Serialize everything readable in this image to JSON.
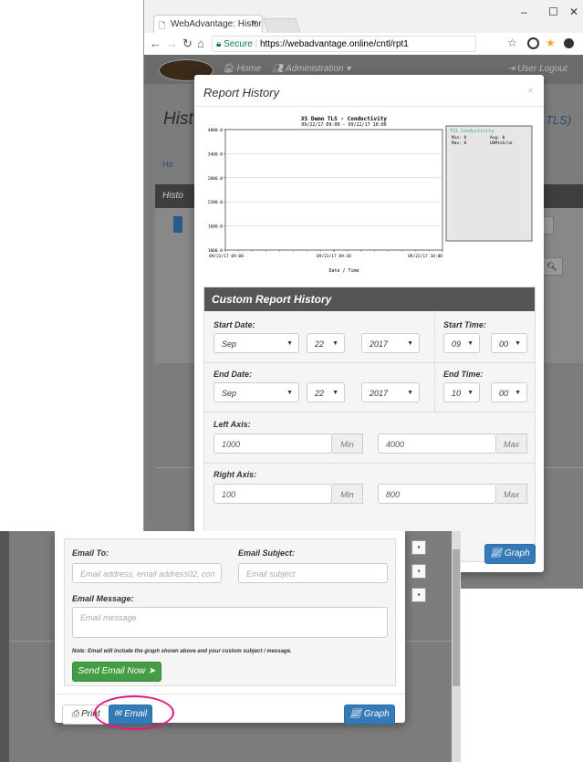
{
  "colors": {
    "primary": "#337ab7",
    "success": "#449d44",
    "highlight": "#e0187f",
    "panel_header": "#555555",
    "overlay": "#7c7c7c"
  },
  "browser": {
    "tab_title": "WebAdvantage: History",
    "tab_close": "×",
    "window_controls": [
      "–",
      "☐",
      "✕"
    ],
    "nav_icons": [
      "back-icon",
      "forward-icon",
      "reload-icon",
      "home-icon"
    ],
    "secure_label": "Secure",
    "url": "https://webadvantage.online/cntl/rpt1"
  },
  "app_nav": {
    "home": "Home",
    "administration": "Administration ▾",
    "logout": "User Logout"
  },
  "background_page": {
    "title_fragment": "Hist",
    "title_suffix": "TLS)",
    "breadcrumb_fragment": "Ho",
    "panel_fragment": "Histo"
  },
  "report_modal": {
    "title": "Report History",
    "close": "×"
  },
  "chart_data": {
    "type": "line",
    "title": "XS Demo TLS - Conductivity",
    "subtitle": "09/22/17 09:00 - 09/22/17 10:00",
    "xlabel": "Date / Time",
    "ylabel": "",
    "x_tick_labels": [
      "09/22/17 09:00",
      "09/22/17 09:30",
      "09/22/17 10:00"
    ],
    "y_tick_labels": [
      "1000.0",
      "1600.0",
      "2200.0",
      "2800.0",
      "3400.0",
      "4000.0"
    ],
    "ylim": [
      1000,
      4000
    ],
    "grid": true,
    "legend_placement": "right",
    "series": [
      {
        "name": "TS1 Conductivity",
        "values": []
      }
    ],
    "legend_stats": {
      "min": "Min: 0",
      "max": "Max: 0",
      "avg": "Avg: 0",
      "units": "UGMtoS/cm"
    }
  },
  "custom_report": {
    "header": "Custom Report History",
    "start_date_label": "Start Date:",
    "start_time_label": "Start Time:",
    "start_month": "Sep",
    "start_day": "22",
    "start_year": "2017",
    "start_hour": "09",
    "start_minute": "00",
    "end_date_label": "End Date:",
    "end_time_label": "End Time:",
    "end_month": "Sep",
    "end_day": "22",
    "end_year": "2017",
    "end_hour": "10",
    "end_minute": "00",
    "left_axis_label": "Left Axis:",
    "left_min": "1000",
    "left_max": "4000",
    "right_axis_label": "Right Axis:",
    "right_min": "100",
    "right_max": "800",
    "min_addon": "Min",
    "max_addon": "Max"
  },
  "graph_button": "Graph",
  "email": {
    "to_label": "Email To:",
    "to_placeholder": "Email address, email address02, con",
    "subject_label": "Email Subject:",
    "subject_placeholder": "Email subject",
    "message_label": "Email Message:",
    "message_placeholder": "Email message",
    "note": "Note: Email will include the graph shown above and your custom subject / message.",
    "send_button": "Send Email Now"
  },
  "footer": {
    "print_button": "Print",
    "email_button": "Email",
    "graph_button": "Graph"
  }
}
